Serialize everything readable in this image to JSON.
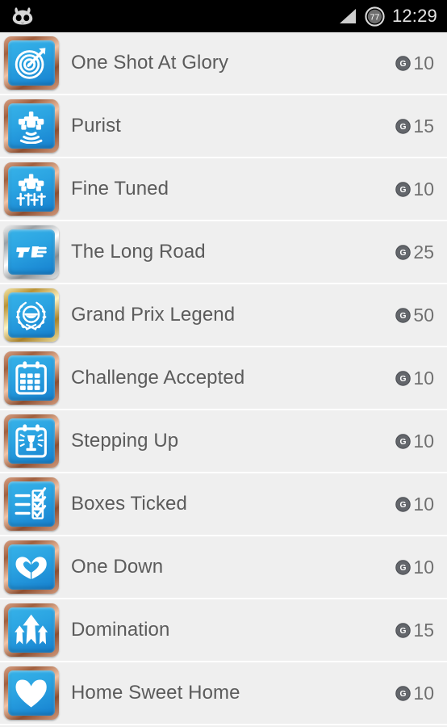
{
  "status_bar": {
    "notification_icon": "cyanogenmod-logo",
    "signal_icon": "signal-bars-icon",
    "battery_icon": "battery-circle-icon",
    "battery_level": "77",
    "time": "12:29"
  },
  "colors": {
    "background": "#efefef",
    "status_bar_background": "#000000",
    "title_text": "#5b5b5b",
    "points_text": "#707070",
    "badge_blue_light": "#37b2e8",
    "badge_blue_dark": "#1680cf",
    "tier_bronze": "#a05f3e",
    "tier_silver": "#9aa0a4",
    "tier_gold": "#b99235",
    "row_divider": "#ffffff"
  },
  "points_icon_label": "G",
  "achievements": [
    {
      "title": "One Shot At Glory",
      "points": "10",
      "icon": "target-arrow-icon",
      "tier": "bronze"
    },
    {
      "title": "Purist",
      "points": "15",
      "icon": "race-car-waves-icon",
      "tier": "bronze"
    },
    {
      "title": "Fine Tuned",
      "points": "10",
      "icon": "race-car-sliders-icon",
      "tier": "bronze"
    },
    {
      "title": "The Long Road",
      "points": "25",
      "icon": "f1-logo-icon",
      "tier": "silver"
    },
    {
      "title": "Grand Prix Legend",
      "points": "50",
      "icon": "laurel-wreath-icon",
      "tier": "gold"
    },
    {
      "title": "Challenge Accepted",
      "points": "10",
      "icon": "calendar-icon",
      "tier": "bronze"
    },
    {
      "title": "Stepping Up",
      "points": "10",
      "icon": "calendar-trophy-icon",
      "tier": "bronze"
    },
    {
      "title": "Boxes Ticked",
      "points": "10",
      "icon": "checklist-icon",
      "tier": "bronze"
    },
    {
      "title": "One Down",
      "points": "10",
      "icon": "hands-heart-icon",
      "tier": "bronze"
    },
    {
      "title": "Domination",
      "points": "15",
      "icon": "three-up-arrows-icon",
      "tier": "bronze"
    },
    {
      "title": "Home Sweet Home",
      "points": "10",
      "icon": "heart-icon",
      "tier": "bronze"
    }
  ]
}
